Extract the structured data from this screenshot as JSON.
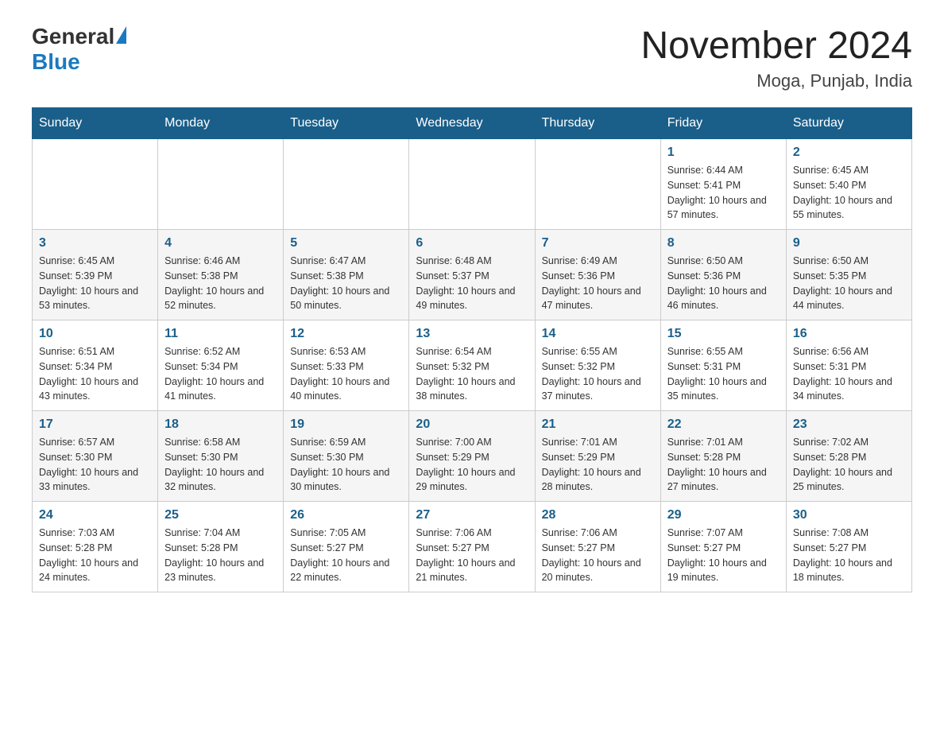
{
  "logo": {
    "general": "General",
    "blue": "Blue"
  },
  "header": {
    "month_year": "November 2024",
    "location": "Moga, Punjab, India"
  },
  "weekdays": [
    "Sunday",
    "Monday",
    "Tuesday",
    "Wednesday",
    "Thursday",
    "Friday",
    "Saturday"
  ],
  "weeks": [
    [
      {
        "day": "",
        "info": ""
      },
      {
        "day": "",
        "info": ""
      },
      {
        "day": "",
        "info": ""
      },
      {
        "day": "",
        "info": ""
      },
      {
        "day": "",
        "info": ""
      },
      {
        "day": "1",
        "info": "Sunrise: 6:44 AM\nSunset: 5:41 PM\nDaylight: 10 hours and 57 minutes."
      },
      {
        "day": "2",
        "info": "Sunrise: 6:45 AM\nSunset: 5:40 PM\nDaylight: 10 hours and 55 minutes."
      }
    ],
    [
      {
        "day": "3",
        "info": "Sunrise: 6:45 AM\nSunset: 5:39 PM\nDaylight: 10 hours and 53 minutes."
      },
      {
        "day": "4",
        "info": "Sunrise: 6:46 AM\nSunset: 5:38 PM\nDaylight: 10 hours and 52 minutes."
      },
      {
        "day": "5",
        "info": "Sunrise: 6:47 AM\nSunset: 5:38 PM\nDaylight: 10 hours and 50 minutes."
      },
      {
        "day": "6",
        "info": "Sunrise: 6:48 AM\nSunset: 5:37 PM\nDaylight: 10 hours and 49 minutes."
      },
      {
        "day": "7",
        "info": "Sunrise: 6:49 AM\nSunset: 5:36 PM\nDaylight: 10 hours and 47 minutes."
      },
      {
        "day": "8",
        "info": "Sunrise: 6:50 AM\nSunset: 5:36 PM\nDaylight: 10 hours and 46 minutes."
      },
      {
        "day": "9",
        "info": "Sunrise: 6:50 AM\nSunset: 5:35 PM\nDaylight: 10 hours and 44 minutes."
      }
    ],
    [
      {
        "day": "10",
        "info": "Sunrise: 6:51 AM\nSunset: 5:34 PM\nDaylight: 10 hours and 43 minutes."
      },
      {
        "day": "11",
        "info": "Sunrise: 6:52 AM\nSunset: 5:34 PM\nDaylight: 10 hours and 41 minutes."
      },
      {
        "day": "12",
        "info": "Sunrise: 6:53 AM\nSunset: 5:33 PM\nDaylight: 10 hours and 40 minutes."
      },
      {
        "day": "13",
        "info": "Sunrise: 6:54 AM\nSunset: 5:32 PM\nDaylight: 10 hours and 38 minutes."
      },
      {
        "day": "14",
        "info": "Sunrise: 6:55 AM\nSunset: 5:32 PM\nDaylight: 10 hours and 37 minutes."
      },
      {
        "day": "15",
        "info": "Sunrise: 6:55 AM\nSunset: 5:31 PM\nDaylight: 10 hours and 35 minutes."
      },
      {
        "day": "16",
        "info": "Sunrise: 6:56 AM\nSunset: 5:31 PM\nDaylight: 10 hours and 34 minutes."
      }
    ],
    [
      {
        "day": "17",
        "info": "Sunrise: 6:57 AM\nSunset: 5:30 PM\nDaylight: 10 hours and 33 minutes."
      },
      {
        "day": "18",
        "info": "Sunrise: 6:58 AM\nSunset: 5:30 PM\nDaylight: 10 hours and 32 minutes."
      },
      {
        "day": "19",
        "info": "Sunrise: 6:59 AM\nSunset: 5:30 PM\nDaylight: 10 hours and 30 minutes."
      },
      {
        "day": "20",
        "info": "Sunrise: 7:00 AM\nSunset: 5:29 PM\nDaylight: 10 hours and 29 minutes."
      },
      {
        "day": "21",
        "info": "Sunrise: 7:01 AM\nSunset: 5:29 PM\nDaylight: 10 hours and 28 minutes."
      },
      {
        "day": "22",
        "info": "Sunrise: 7:01 AM\nSunset: 5:28 PM\nDaylight: 10 hours and 27 minutes."
      },
      {
        "day": "23",
        "info": "Sunrise: 7:02 AM\nSunset: 5:28 PM\nDaylight: 10 hours and 25 minutes."
      }
    ],
    [
      {
        "day": "24",
        "info": "Sunrise: 7:03 AM\nSunset: 5:28 PM\nDaylight: 10 hours and 24 minutes."
      },
      {
        "day": "25",
        "info": "Sunrise: 7:04 AM\nSunset: 5:28 PM\nDaylight: 10 hours and 23 minutes."
      },
      {
        "day": "26",
        "info": "Sunrise: 7:05 AM\nSunset: 5:27 PM\nDaylight: 10 hours and 22 minutes."
      },
      {
        "day": "27",
        "info": "Sunrise: 7:06 AM\nSunset: 5:27 PM\nDaylight: 10 hours and 21 minutes."
      },
      {
        "day": "28",
        "info": "Sunrise: 7:06 AM\nSunset: 5:27 PM\nDaylight: 10 hours and 20 minutes."
      },
      {
        "day": "29",
        "info": "Sunrise: 7:07 AM\nSunset: 5:27 PM\nDaylight: 10 hours and 19 minutes."
      },
      {
        "day": "30",
        "info": "Sunrise: 7:08 AM\nSunset: 5:27 PM\nDaylight: 10 hours and 18 minutes."
      }
    ]
  ]
}
